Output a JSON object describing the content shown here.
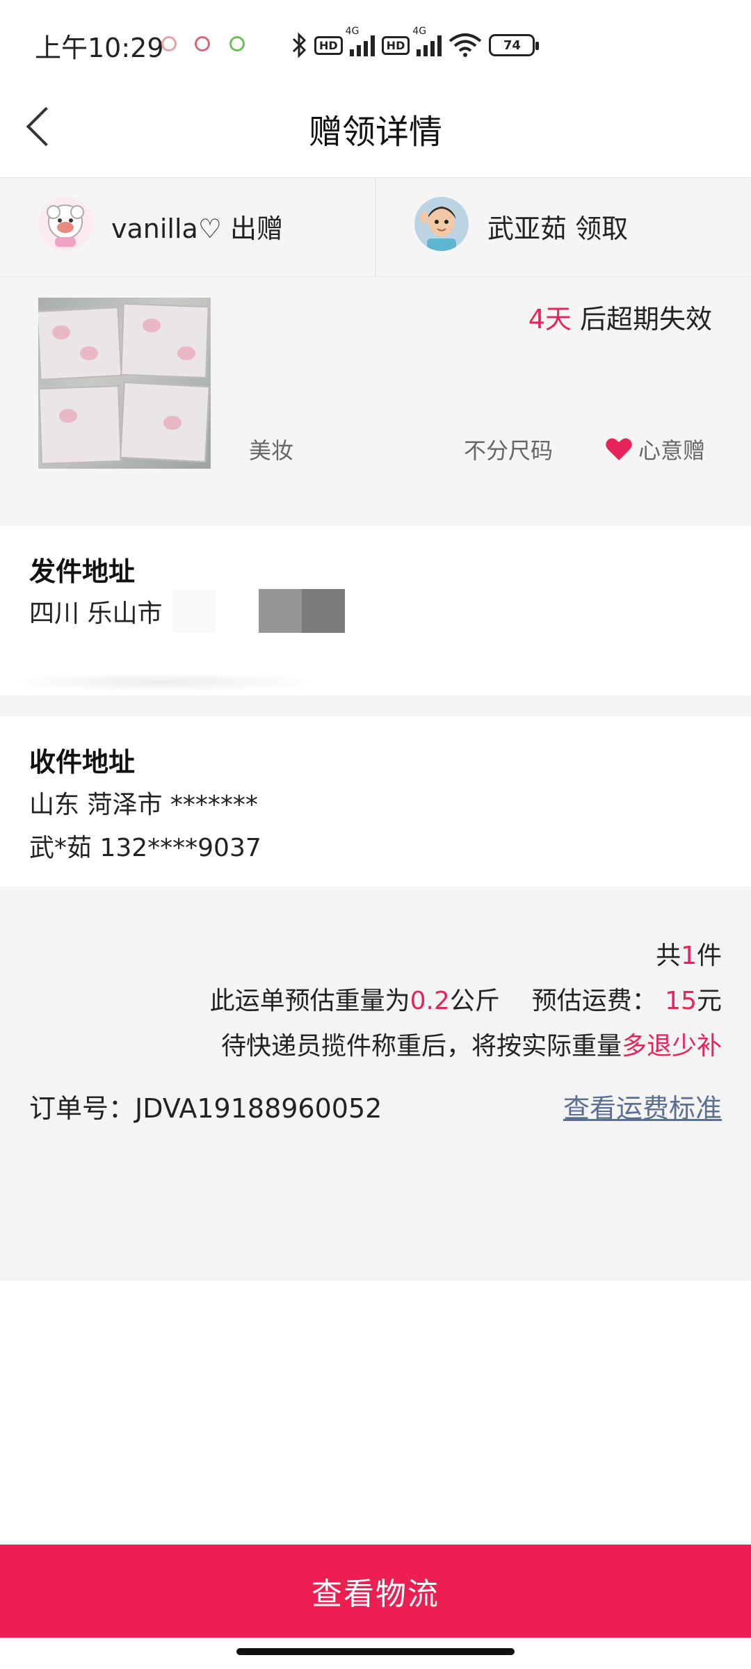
{
  "status_bar": {
    "time": "上午10:29",
    "network_label_1": "4G",
    "network_label_2": "4G",
    "hd_label_1": "HD",
    "hd_label_2": "HD",
    "battery": "74"
  },
  "header": {
    "title": "赠领详情"
  },
  "giver": {
    "name": "vanilla♡",
    "action": "出赠"
  },
  "receiver": {
    "name": "武亚茹",
    "action": "领取"
  },
  "product": {
    "expiry_days": "4天",
    "expiry_text": "后超期失效",
    "category": "美妆",
    "size": "不分尺码",
    "gift_type": "心意赠"
  },
  "sender_address": {
    "title": "发件地址",
    "line": "四川 乐山市"
  },
  "receiver_address": {
    "title": "收件地址",
    "line1": "山东 菏泽市 *******",
    "line2": "武*茹 132****9037"
  },
  "summary": {
    "count_prefix": "共",
    "count": "1",
    "count_suffix": "件",
    "weight_prefix": "此运单预估重量为",
    "weight_value": "0.2",
    "weight_unit": "公斤",
    "fee_label": "预估运费：",
    "fee_value": "15",
    "fee_unit": "元",
    "note_prefix": "待快递员揽件称重后，将按实际重量",
    "note_highlight": "多退少补",
    "order_label": "订单号：",
    "order_number": "JDVA19188960052",
    "fee_standard_link": "查看运费标准"
  },
  "bottom_button": {
    "label": "查看物流"
  },
  "colors": {
    "accent": "#ec1e52",
    "highlight": "#e6245a",
    "link": "#5b6f93"
  }
}
